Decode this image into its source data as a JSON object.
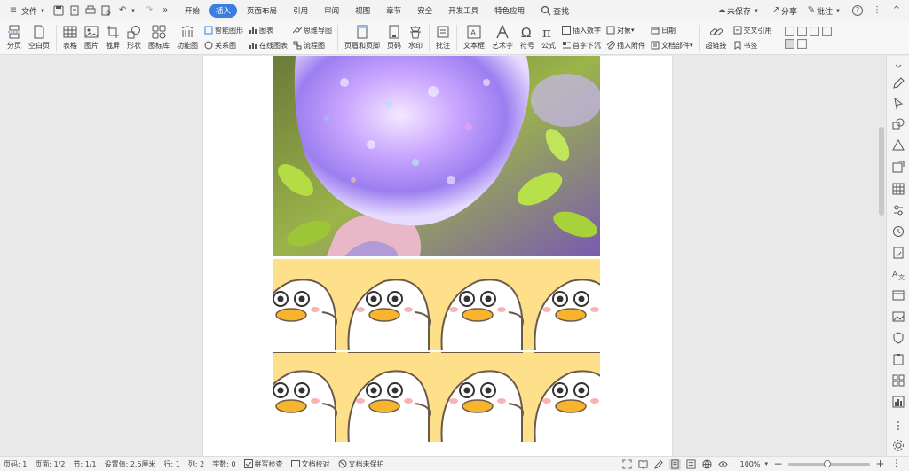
{
  "menubar": {
    "file_label": "文件",
    "more_label": "»",
    "tabs": [
      "开始",
      "插入",
      "页面布局",
      "引用",
      "审阅",
      "视图",
      "章节",
      "安全",
      "开发工具",
      "特色应用"
    ],
    "active_tab": "插入",
    "search_label": "查找",
    "unsaved_label": "未保存",
    "share_label": "分享",
    "comment_label": "批注",
    "help_label": "?",
    "dots_label": "⋮",
    "collapse_label": "^"
  },
  "ribbon": {
    "page_break": "分页",
    "blank_page": "空白页",
    "table": "表格",
    "picture": "图片",
    "screenshot": "截屏",
    "shape": "形状",
    "icon_lib": "图标库",
    "func_chart": "功能图",
    "smart_shape": "智能图形",
    "relation": "关系图",
    "chart": "图表",
    "online_chart": "在线图表",
    "mindmap": "思维导图",
    "flowchart": "流程图",
    "header_footer": "页眉和页脚",
    "page_num": "页码",
    "watermark": "水印",
    "comment": "批注",
    "textbox": "文本框",
    "art_text": "艺术字",
    "symbol": "符号",
    "formula": "公式",
    "insert_number": "插入数字",
    "object": "对象",
    "drop_cap": "首字下沉",
    "insert_attach": "插入附件",
    "date": "日期",
    "doc_parts": "文档部件",
    "hyperlink": "超链接",
    "cross_ref": "交叉引用",
    "bookmark": "书签"
  },
  "status": {
    "page_num": "页码: 1",
    "pages": "页面: 1/2",
    "section": "节: 1/1",
    "setting": "设置值: 2.5厘米",
    "row": "行: 1",
    "col": "列: 2",
    "words": "字数: 0",
    "spell": "拼写检查",
    "proof": "文档校对",
    "protect": "文档未保护",
    "zoom": "100%",
    "zoom_fraction": 0.48
  },
  "colors": {
    "accent": "#3d7de0",
    "duck_bg": "#ffe08a",
    "duck_bill": "#f7b42c"
  }
}
